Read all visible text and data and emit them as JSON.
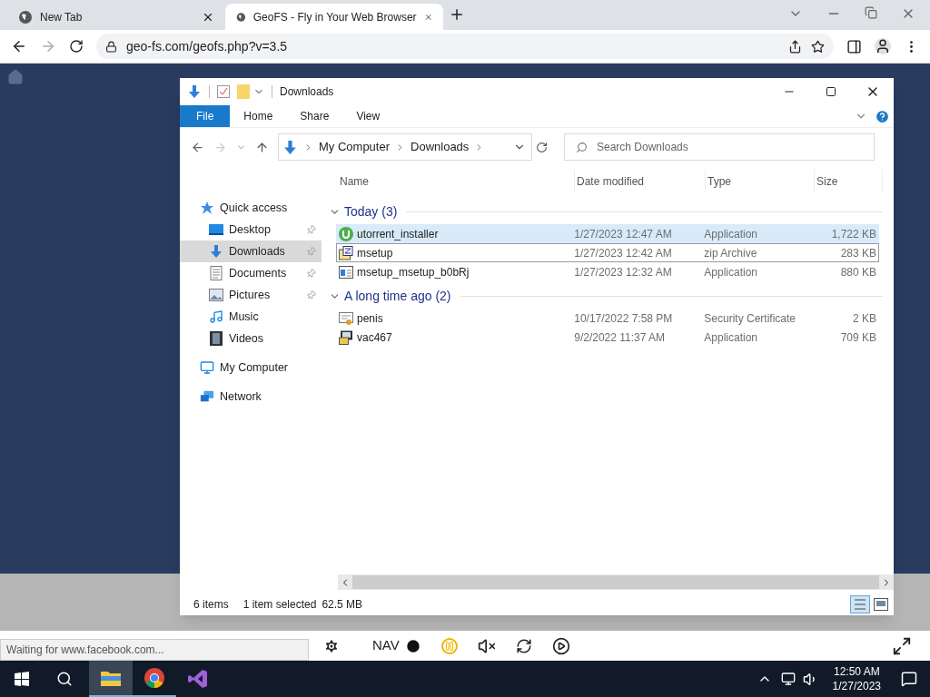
{
  "browser": {
    "tabs": [
      {
        "title": "New Tab",
        "selected": false
      },
      {
        "title": "GeoFS - Fly in Your Web Browser",
        "selected": true
      }
    ],
    "url": "geo-fs.com/geofs.php?v=3.5"
  },
  "explorer": {
    "title": "Downloads",
    "ribbon_tabs": [
      {
        "label": "File",
        "kind": "file",
        "selected": false
      },
      {
        "label": "Home",
        "kind": "tab",
        "selected": false
      },
      {
        "label": "Share",
        "kind": "tab",
        "selected": false
      },
      {
        "label": "View",
        "kind": "tab",
        "selected": false
      }
    ],
    "breadcrumbs": [
      "My Computer",
      "Downloads"
    ],
    "search": {
      "placeholder": "Search Downloads"
    },
    "nav": [
      {
        "label": "Quick access",
        "kind": "star",
        "pinned": false,
        "selected": false
      },
      {
        "label": "Desktop",
        "kind": "desktop",
        "pinned": true,
        "selected": false
      },
      {
        "label": "Downloads",
        "kind": "download",
        "pinned": true,
        "selected": true
      },
      {
        "label": "Documents",
        "kind": "document",
        "pinned": true,
        "selected": false
      },
      {
        "label": "Pictures",
        "kind": "pictures",
        "pinned": true,
        "selected": false
      },
      {
        "label": "Music",
        "kind": "music",
        "pinned": false,
        "selected": false
      },
      {
        "label": "Videos",
        "kind": "videos",
        "pinned": false,
        "selected": false
      },
      {
        "label": "My Computer",
        "kind": "computer",
        "pinned": false,
        "selected": false
      },
      {
        "label": "Network",
        "kind": "network",
        "pinned": false,
        "selected": false
      }
    ],
    "columns": [
      "Name",
      "Date modified",
      "Type",
      "Size"
    ],
    "groups": [
      {
        "title": "Today (3)",
        "files": [
          {
            "name": "utorrent_installer",
            "date": "1/27/2023 12:47 AM",
            "type": "Application",
            "size": "1,722 KB",
            "kind": "torrent",
            "selected": true,
            "focused": false
          },
          {
            "name": "msetup",
            "date": "1/27/2023 12:42 AM",
            "type": "zip Archive",
            "size": "283 KB",
            "kind": "zip",
            "selected": false,
            "focused": true
          },
          {
            "name": "msetup_msetup_b0bRj",
            "date": "1/27/2023 12:32 AM",
            "type": "Application",
            "size": "880 KB",
            "kind": "app",
            "selected": false,
            "focused": false
          }
        ]
      },
      {
        "title": "A long time ago (2)",
        "files": [
          {
            "name": "penis",
            "date": "10/17/2022 7:58 PM",
            "type": "Security Certificate",
            "size": "2 KB",
            "kind": "cert",
            "selected": false,
            "focused": false
          },
          {
            "name": "vac467",
            "date": "9/2/2022 11:37 AM",
            "type": "Application",
            "size": "709 KB",
            "kind": "setup",
            "selected": false,
            "focused": false
          }
        ]
      }
    ],
    "status": {
      "items": "6 items",
      "selection": "1 item selected",
      "size": "62.5 MB"
    }
  },
  "game": {
    "nav_label": "NAV",
    "loading": "Waiting for www.facebook.com..."
  },
  "taskbar": {
    "time": "12:50 AM",
    "date": "1/27/2023"
  }
}
